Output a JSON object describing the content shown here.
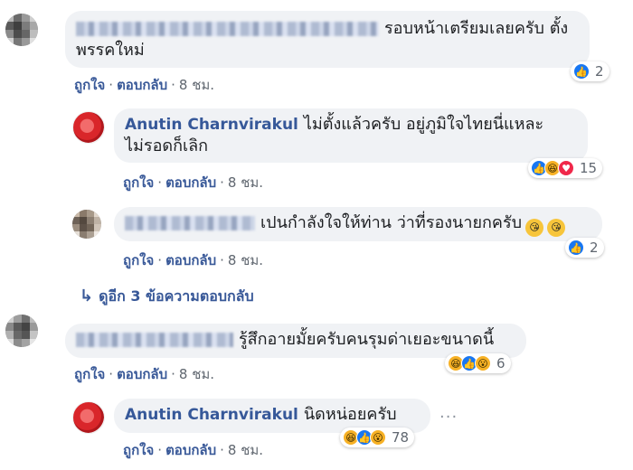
{
  "comments": [
    {
      "text": "รอบหน้าเตรียมเลยครับ ตั้งพรรคใหม่",
      "line1": "รอบหน้าเตรียมเลยครับ ตั้ง",
      "line2": "พรรคใหม่",
      "actions": {
        "like": "ถูกใจ",
        "reply": "ตอบกลับ",
        "time": "8 ชม."
      },
      "reactions": {
        "icons": [
          "like"
        ],
        "count": "2"
      }
    },
    {
      "author": "Anutin Charnvirakul",
      "line1": "ไม่ตั้งแล้วครับ อยู่ภูมิใจไทยนี่แหละ",
      "line2": "ไม่รอดก็เลิก",
      "actions": {
        "like": "ถูกใจ",
        "reply": "ตอบกลับ",
        "time": "8 ชม."
      },
      "reactions": {
        "icons": [
          "like",
          "haha",
          "love"
        ],
        "count": "15"
      }
    },
    {
      "line1": "เปนกำลังใจให้ท่าน ว่าที่รองนายกครับ",
      "actions": {
        "like": "ถูกใจ",
        "reply": "ตอบกลับ",
        "time": "8 ชม."
      },
      "reactions": {
        "icons": [
          "like"
        ],
        "count": "2"
      }
    },
    {
      "line1": "รู้สึกอายมั้ยครับคนรุมด่าเยอะขนาดนี้",
      "actions": {
        "like": "ถูกใจ",
        "reply": "ตอบกลับ",
        "time": "8 ชม."
      },
      "reactions": {
        "icons": [
          "haha",
          "like",
          "wow"
        ],
        "count": "6"
      }
    },
    {
      "author": "Anutin Charnvirakul",
      "line1": "นิดหน่อยครับ",
      "actions": {
        "like": "ถูกใจ",
        "reply": "ตอบกลับ",
        "time": "8 ชม."
      },
      "reactions": {
        "icons": [
          "haha",
          "like",
          "wow"
        ],
        "count": "78"
      }
    }
  ],
  "more_replies": "ดูอีก 3 ข้อความตอบกลับ",
  "separator": "·",
  "ellipsis": "···",
  "icons": {
    "like": "thumbs-up-icon",
    "haha": "laughing-face-icon",
    "love": "heart-icon",
    "wow": "surprised-face-icon",
    "reply_arrow": "reply-arrow-icon",
    "more": "more-options-icon"
  },
  "colors": {
    "author": "#365899",
    "link": "#385898",
    "bubble": "#f0f2f5",
    "like": "#1877f2",
    "love": "#f0284a",
    "haha": "#f7b125"
  }
}
